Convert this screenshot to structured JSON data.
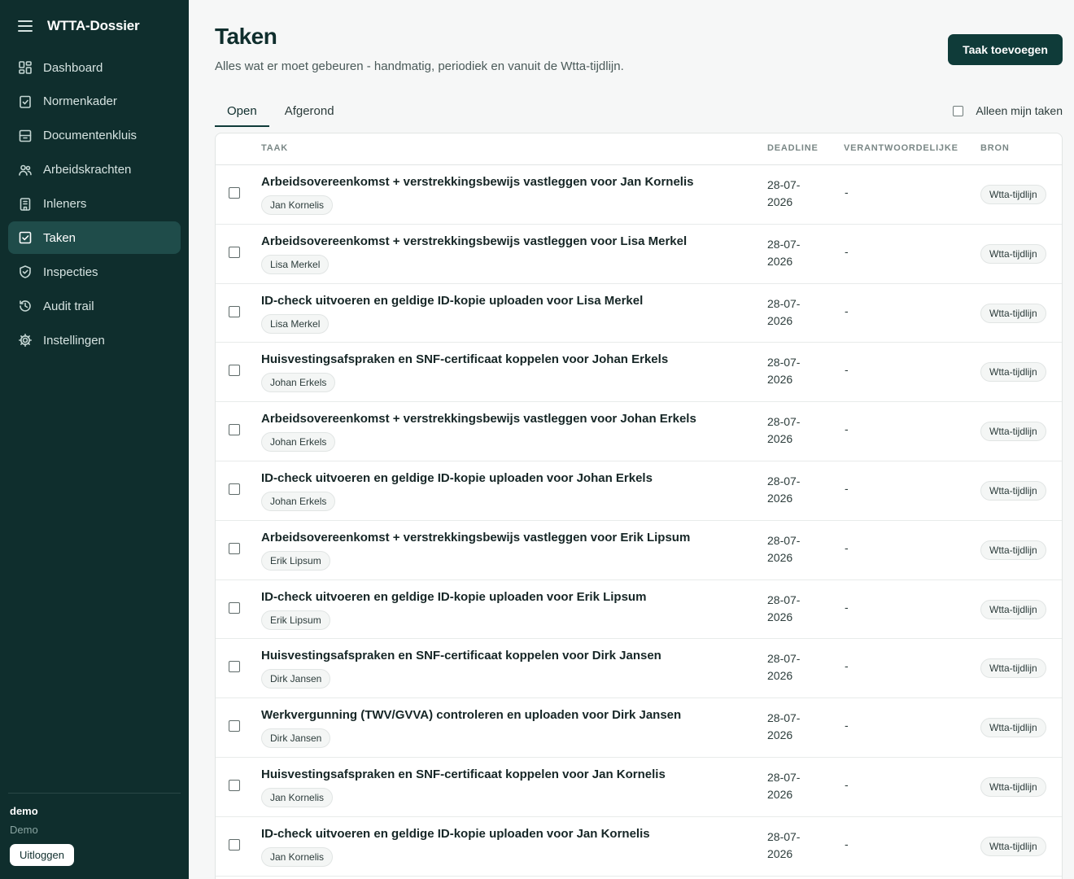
{
  "app": {
    "name": "WTTA-Dossier"
  },
  "sidebar": {
    "items": [
      {
        "label": "Dashboard",
        "icon": "dashboard-icon",
        "active": false
      },
      {
        "label": "Normenkader",
        "icon": "clipboard-check-icon",
        "active": false
      },
      {
        "label": "Documentenkluis",
        "icon": "archive-icon",
        "active": false
      },
      {
        "label": "Arbeidskrachten",
        "icon": "users-icon",
        "active": false
      },
      {
        "label": "Inleners",
        "icon": "building-icon",
        "active": false
      },
      {
        "label": "Taken",
        "icon": "checkbox-icon",
        "active": true
      },
      {
        "label": "Inspecties",
        "icon": "shield-check-icon",
        "active": false
      },
      {
        "label": "Audit trail",
        "icon": "history-icon",
        "active": false
      },
      {
        "label": "Instellingen",
        "icon": "gear-icon",
        "active": false
      }
    ],
    "user": {
      "name": "demo",
      "org": "Demo",
      "logout_label": "Uitloggen"
    }
  },
  "page": {
    "title": "Taken",
    "subtitle": "Alles wat er moet gebeuren - handmatig, periodiek en vanuit de Wtta-tijdlijn.",
    "add_button": "Taak toevoegen"
  },
  "tabs": [
    {
      "label": "Open",
      "active": true
    },
    {
      "label": "Afgerond",
      "active": false
    }
  ],
  "filter": {
    "mine_only_label": "Alleen mijn taken",
    "checked": false
  },
  "table": {
    "headers": {
      "task": "TAAK",
      "deadline": "DEADLINE",
      "owner": "VERANTWOORDELIJKE",
      "source": "BRON"
    },
    "rows": [
      {
        "title": "Arbeidsovereenkomst + verstrekkingsbewijs vastleggen voor Jan Kornelis",
        "person": "Jan Kornelis",
        "deadline_line1": "28-07-",
        "deadline_line2": "2026",
        "owner": "-",
        "source": "Wtta-tijdlijn"
      },
      {
        "title": "Arbeidsovereenkomst + verstrekkingsbewijs vastleggen voor Lisa Merkel",
        "person": "Lisa Merkel",
        "deadline_line1": "28-07-",
        "deadline_line2": "2026",
        "owner": "-",
        "source": "Wtta-tijdlijn"
      },
      {
        "title": "ID-check uitvoeren en geldige ID-kopie uploaden voor Lisa Merkel",
        "person": "Lisa Merkel",
        "deadline_line1": "28-07-",
        "deadline_line2": "2026",
        "owner": "-",
        "source": "Wtta-tijdlijn"
      },
      {
        "title": "Huisvestingsafspraken en SNF-certificaat koppelen voor Johan Erkels",
        "person": "Johan Erkels",
        "deadline_line1": "28-07-",
        "deadline_line2": "2026",
        "owner": "-",
        "source": "Wtta-tijdlijn"
      },
      {
        "title": "Arbeidsovereenkomst + verstrekkingsbewijs vastleggen voor Johan Erkels",
        "person": "Johan Erkels",
        "deadline_line1": "28-07-",
        "deadline_line2": "2026",
        "owner": "-",
        "source": "Wtta-tijdlijn"
      },
      {
        "title": "ID-check uitvoeren en geldige ID-kopie uploaden voor Johan Erkels",
        "person": "Johan Erkels",
        "deadline_line1": "28-07-",
        "deadline_line2": "2026",
        "owner": "-",
        "source": "Wtta-tijdlijn"
      },
      {
        "title": "Arbeidsovereenkomst + verstrekkingsbewijs vastleggen voor Erik Lipsum",
        "person": "Erik Lipsum",
        "deadline_line1": "28-07-",
        "deadline_line2": "2026",
        "owner": "-",
        "source": "Wtta-tijdlijn"
      },
      {
        "title": "ID-check uitvoeren en geldige ID-kopie uploaden voor Erik Lipsum",
        "person": "Erik Lipsum",
        "deadline_line1": "28-07-",
        "deadline_line2": "2026",
        "owner": "-",
        "source": "Wtta-tijdlijn"
      },
      {
        "title": "Huisvestingsafspraken en SNF-certificaat koppelen voor Dirk Jansen",
        "person": "Dirk Jansen",
        "deadline_line1": "28-07-",
        "deadline_line2": "2026",
        "owner": "-",
        "source": "Wtta-tijdlijn"
      },
      {
        "title": "Werkvergunning (TWV/GVVA) controleren en uploaden voor Dirk Jansen",
        "person": "Dirk Jansen",
        "deadline_line1": "28-07-",
        "deadline_line2": "2026",
        "owner": "-",
        "source": "Wtta-tijdlijn"
      },
      {
        "title": "Huisvestingsafspraken en SNF-certificaat koppelen voor Jan Kornelis",
        "person": "Jan Kornelis",
        "deadline_line1": "28-07-",
        "deadline_line2": "2026",
        "owner": "-",
        "source": "Wtta-tijdlijn"
      },
      {
        "title": "ID-check uitvoeren en geldige ID-kopie uploaden voor Jan Kornelis",
        "person": "Jan Kornelis",
        "deadline_line1": "28-07-",
        "deadline_line2": "2026",
        "owner": "-",
        "source": "Wtta-tijdlijn"
      }
    ]
  },
  "colors": {
    "sidebar_bg": "#0f2e2d",
    "sidebar_active": "#1f4c4a",
    "primary_button": "#0f3b39",
    "page_bg": "#f6f7f7"
  }
}
